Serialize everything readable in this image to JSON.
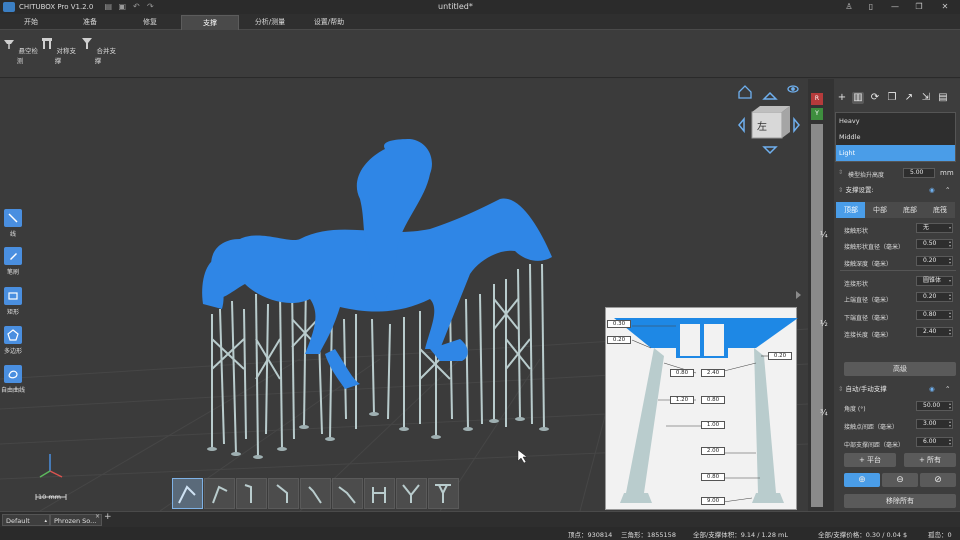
{
  "app": {
    "title": "CHITUBOX Pro V1.2.0",
    "document_title": "untitled*"
  },
  "tabs": [
    {
      "label": "开始"
    },
    {
      "label": "准备"
    },
    {
      "label": "修复"
    },
    {
      "label": "支撑",
      "active": true
    },
    {
      "label": "分析/测量"
    },
    {
      "label": "设置/帮助"
    }
  ],
  "toolbar": {
    "items": [
      {
        "label": "悬空检测",
        "icon": "overhang-icon"
      },
      {
        "label": "对称支撑",
        "icon": "symmetry-support-icon"
      },
      {
        "label": "合并支撑",
        "icon": "merge-support-icon"
      }
    ]
  },
  "left_tools": [
    {
      "label": "线",
      "icon": "line-icon"
    },
    {
      "label": "笔刷",
      "icon": "brush-icon"
    },
    {
      "label": "矩形",
      "icon": "rectangle-icon"
    },
    {
      "label": "多边形",
      "icon": "polygon-icon"
    },
    {
      "label": "自由曲线",
      "icon": "freehand-icon"
    }
  ],
  "view_cube": {
    "label": "左"
  },
  "scale_label": "10 mm",
  "vertical_slider": {
    "marks": [
      "¼",
      "½",
      "¾"
    ],
    "top_markers": [
      "R",
      "Y"
    ]
  },
  "support_diagram": {
    "labels": [
      "0.30",
      "0.20",
      "0.20",
      "0.80",
      "2.40",
      "1.20",
      "0.80",
      "1.00",
      "2.00",
      "0.80",
      "9.00"
    ]
  },
  "right_panel": {
    "profiles": [
      {
        "label": "Heavy"
      },
      {
        "label": "Middle"
      },
      {
        "label": "Light",
        "selected": true
      }
    ],
    "lift_height_label": "模型抬升高度",
    "lift_height_value": "5.00",
    "lift_height_unit": "mm",
    "support_settings_label": "支撑设置:",
    "sub_tabs": [
      {
        "label": "顶部",
        "active": true
      },
      {
        "label": "中部"
      },
      {
        "label": "底部"
      },
      {
        "label": "底筏"
      }
    ],
    "params": [
      {
        "label": "接触形状",
        "value": "无"
      },
      {
        "label": "接触形状直径（毫米）",
        "value": "0.50"
      },
      {
        "label": "接触深度（毫米）",
        "value": "0.20"
      },
      {
        "label": "连接形状",
        "value": "圆锥体"
      },
      {
        "label": "上端直径（毫米）",
        "value": "0.20"
      },
      {
        "label": "下端直径（毫米）",
        "value": "0.80"
      },
      {
        "label": "连接长度（毫米）",
        "value": "2.40"
      }
    ],
    "advanced_label": "高级",
    "auto_manual_label": "自动/手动支撑",
    "auto_params": [
      {
        "label": "角度 (°)",
        "value": "50.00"
      },
      {
        "label": "接触点间距（毫米）",
        "value": "3.00"
      },
      {
        "label": "中部支撑间距（毫米）",
        "value": "6.00"
      }
    ],
    "add_platform_label": "+ 平台",
    "add_all_label": "+ 所有",
    "remove_all_label": "移除所有"
  },
  "bottom_tabs": [
    {
      "label": "Default"
    },
    {
      "label": "Phrozen So..."
    }
  ],
  "status": {
    "vertices": "顶点：930814",
    "triangles": "三角形：1855158",
    "volume": "全部/支撑体积：9.14 / 1.28 mL",
    "price": "全部/支撑价格：0.30 / 0.04 $",
    "islands": "孤岛：0"
  },
  "colors": {
    "accent": "#4a9de8",
    "model": "#2f86e6",
    "support": "#b9cccd",
    "background": "#3a3a3a"
  }
}
